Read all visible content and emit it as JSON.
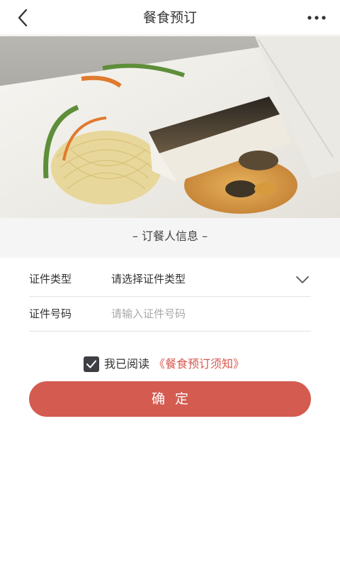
{
  "header": {
    "title": "餐食预订",
    "back_icon": "chevron-left-icon",
    "more_icon": "more-horizontal-icon"
  },
  "hero": {
    "image": "plated fish with noodles"
  },
  "section": {
    "title": "– 订餐人信息 –"
  },
  "form": {
    "id_type": {
      "label": "证件类型",
      "value": "请选择证件类型",
      "icon": "chevron-down-icon"
    },
    "id_number": {
      "label": "证件号码",
      "placeholder": "请输入证件号码",
      "value": ""
    }
  },
  "agreement": {
    "checked": true,
    "text": "我已阅读",
    "link": "《餐食预订须知》"
  },
  "actions": {
    "confirm_label": "确定"
  },
  "colors": {
    "accent": "#d45b50",
    "link": "#d9584e",
    "checkbox": "#3d3f45"
  }
}
